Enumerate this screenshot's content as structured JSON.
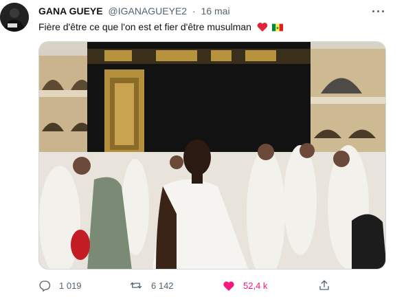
{
  "user": {
    "display_name": "GANA GUEYE",
    "handle": "@IGANAGUEYE2",
    "separator": "·",
    "date": "16 mai",
    "avatar_icon": "profile-avatar"
  },
  "tweet": {
    "text": "Fière d'être ce que l'on est et fier d'être musulman",
    "emojis": [
      "red-heart",
      "senegal-flag"
    ],
    "media_description_icon": "photo"
  },
  "actions": {
    "reply": {
      "icon": "reply-icon",
      "count": "1 019"
    },
    "retweet": {
      "icon": "retweet-icon",
      "count": "6 142"
    },
    "like": {
      "icon": "heart-icon",
      "count": "52,4 k",
      "active": true
    },
    "share": {
      "icon": "share-icon"
    }
  },
  "colors": {
    "text_primary": "#0f1419",
    "text_secondary": "#536471",
    "like_active": "#f91880",
    "border": "#cfd9de"
  }
}
